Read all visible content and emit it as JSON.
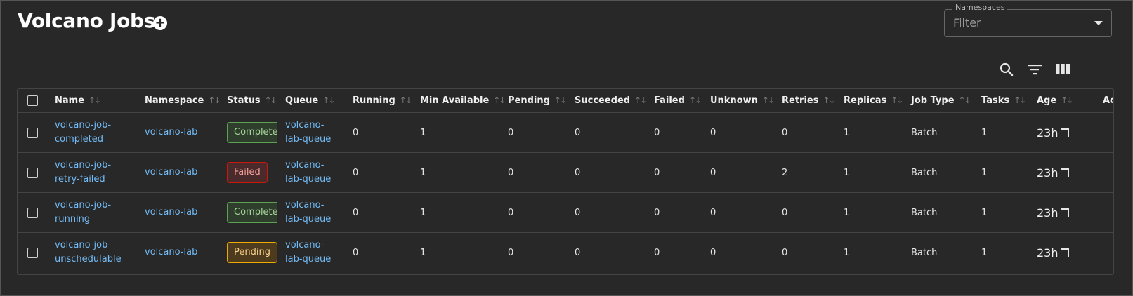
{
  "header": {
    "title": "Volcano Jobs",
    "add_label": "+"
  },
  "namespaces": {
    "label": "Namespaces",
    "placeholder": "Filter"
  },
  "toolbar": {
    "icons": [
      "search-icon",
      "filter-icon",
      "columns-icon"
    ]
  },
  "table": {
    "columns": [
      "Name",
      "Namespace",
      "Status",
      "Queue",
      "Running",
      "Min Available",
      "Pending",
      "Succeeded",
      "Failed",
      "Unknown",
      "Retries",
      "Replicas",
      "Job Type",
      "Tasks",
      "Age",
      "Actions"
    ],
    "rows": [
      {
        "name_1": "volcano-job-",
        "name_2": "completed",
        "namespace": "volcano-lab",
        "status": "Completed",
        "status_kind": "completed",
        "queue_1": "volcano-",
        "queue_2": "lab-queue",
        "running": "0",
        "min_available": "1",
        "pending": "0",
        "succeeded": "0",
        "failed": "0",
        "unknown": "0",
        "retries": "0",
        "replicas": "1",
        "job_type": "Batch",
        "tasks": "1",
        "age": "23h"
      },
      {
        "name_1": "volcano-job-",
        "name_2": "retry-failed",
        "namespace": "volcano-lab",
        "status": "Failed",
        "status_kind": "failed",
        "queue_1": "volcano-",
        "queue_2": "lab-queue",
        "running": "0",
        "min_available": "1",
        "pending": "0",
        "succeeded": "0",
        "failed": "0",
        "unknown": "0",
        "retries": "2",
        "replicas": "1",
        "job_type": "Batch",
        "tasks": "1",
        "age": "23h"
      },
      {
        "name_1": "volcano-job-",
        "name_2": "running",
        "namespace": "volcano-lab",
        "status": "Completed",
        "status_kind": "completed",
        "queue_1": "volcano-",
        "queue_2": "lab-queue",
        "running": "0",
        "min_available": "1",
        "pending": "0",
        "succeeded": "0",
        "failed": "0",
        "unknown": "0",
        "retries": "0",
        "replicas": "1",
        "job_type": "Batch",
        "tasks": "1",
        "age": "23h"
      },
      {
        "name_1": "volcano-job-",
        "name_2": "unschedulable",
        "namespace": "volcano-lab",
        "status": "Pending",
        "status_kind": "pending",
        "queue_1": "volcano-",
        "queue_2": "lab-queue",
        "running": "0",
        "min_available": "1",
        "pending": "0",
        "succeeded": "0",
        "failed": "0",
        "unknown": "0",
        "retries": "0",
        "replicas": "1",
        "job_type": "Batch",
        "tasks": "1",
        "age": "23h"
      }
    ]
  },
  "colors": {
    "background": "#282828",
    "link": "#73bcf7",
    "completed": "#5ba352",
    "failed": "#c9190b",
    "pending": "#f0ab00"
  }
}
